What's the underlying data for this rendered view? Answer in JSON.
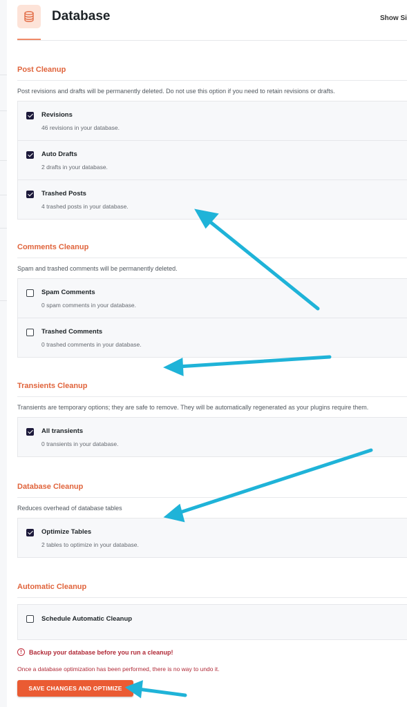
{
  "header": {
    "title": "Database",
    "show_side": "Show Si",
    "icon": "database-icon",
    "accent_color": "#e0643c"
  },
  "sections": [
    {
      "title": "Post Cleanup",
      "description": "Post revisions and drafts will be permanently deleted. Do not use this option if you need to retain revisions or drafts.",
      "options": [
        {
          "label": "Revisions",
          "sub": "46 revisions in your database.",
          "checked": true
        },
        {
          "label": "Auto Drafts",
          "sub": "2 drafts in your database.",
          "checked": true
        },
        {
          "label": "Trashed Posts",
          "sub": "4 trashed posts in your database.",
          "checked": true
        }
      ]
    },
    {
      "title": "Comments Cleanup",
      "description": "Spam and trashed comments will be permanently deleted.",
      "options": [
        {
          "label": "Spam Comments",
          "sub": "0 spam comments in your database.",
          "checked": false
        },
        {
          "label": "Trashed Comments",
          "sub": "0 trashed comments in your database.",
          "checked": false
        }
      ]
    },
    {
      "title": "Transients Cleanup",
      "description": "Transients are temporary options; they are safe to remove. They will be automatically regenerated as your plugins require them.",
      "options": [
        {
          "label": "All transients",
          "sub": "0 transients in your database.",
          "checked": true
        }
      ]
    },
    {
      "title": "Database Cleanup",
      "description": "Reduces overhead of database tables",
      "options": [
        {
          "label": "Optimize Tables",
          "sub": "2 tables to optimize in your database.",
          "checked": true
        }
      ]
    },
    {
      "title": "Automatic Cleanup",
      "description": "",
      "options": [
        {
          "label": "Schedule Automatic Cleanup",
          "sub": "",
          "checked": false
        }
      ]
    }
  ],
  "warning": "Backup your database before you run a cleanup!",
  "note": "Once a database optimization has been performed, there is no way to undo it.",
  "save_button": "SAVE CHANGES AND OPTIMIZE",
  "colors": {
    "button": "#ea5b33",
    "warning": "#b02a37",
    "checkbox_checked": "#1d1a3b",
    "annotation_arrow": "#1fb3d8"
  }
}
